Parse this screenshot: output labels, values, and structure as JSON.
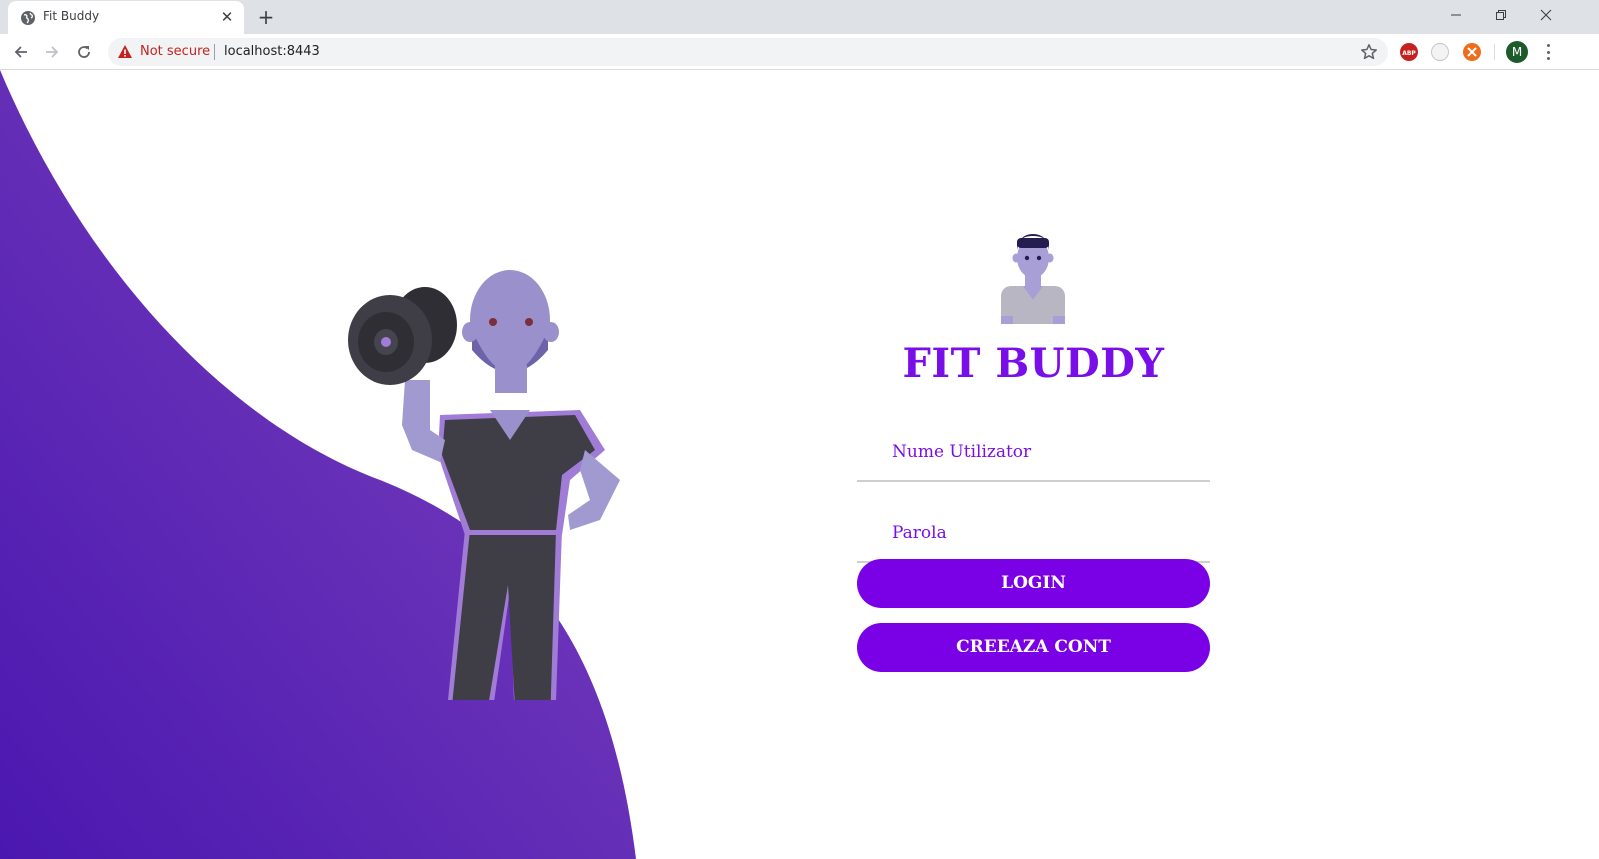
{
  "browser": {
    "tab_title": "Fit Buddy",
    "tab_close": "✕",
    "new_tab": "+",
    "security_label": "Not secure",
    "url": "localhost:8443",
    "profile_initial": "M",
    "extensions": [
      "adblock-icon",
      "extension-icon",
      "extension-icon"
    ]
  },
  "login": {
    "title": "FIT BUDDY",
    "username_placeholder": "Nume Utilizator",
    "password_placeholder": "Parola",
    "login_button": "LOGIN",
    "create_account_button": "CREEAZA CONT"
  },
  "colors": {
    "accent": "#7a0ee8",
    "button": "#7a00e6",
    "wave_dark": "#4a17b0",
    "wave_light": "#7b3fbd"
  }
}
